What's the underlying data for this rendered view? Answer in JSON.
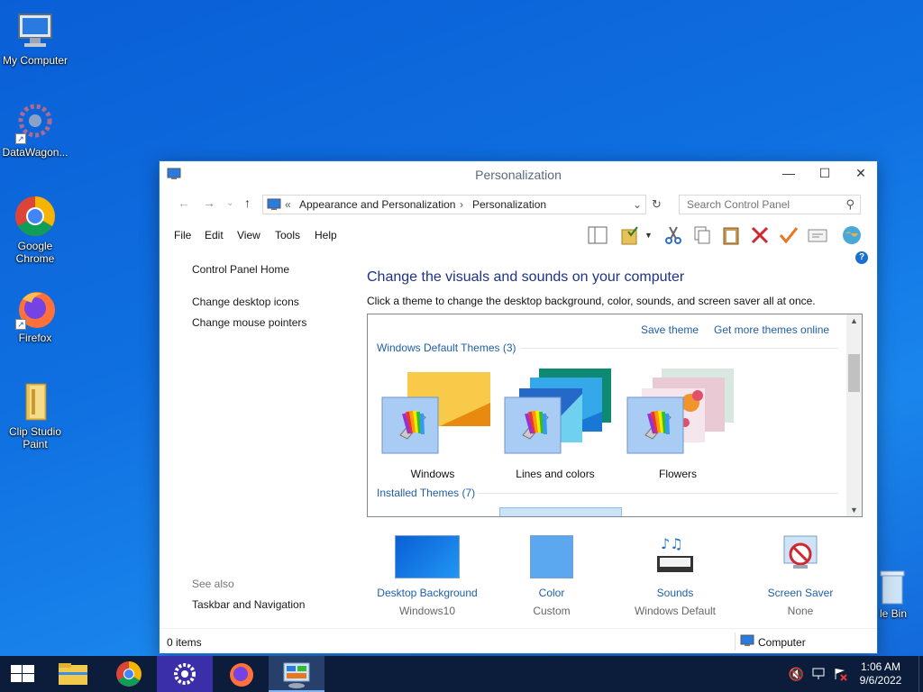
{
  "desktop": {
    "icons": [
      {
        "label": "My Computer"
      },
      {
        "label": "DataWagon..."
      },
      {
        "label": "Google Chrome"
      },
      {
        "label": "Firefox"
      },
      {
        "label": "Clip Studio Paint"
      },
      {
        "label": "le Bin"
      }
    ]
  },
  "window": {
    "title": "Personalization",
    "controls": {
      "minimize": "—",
      "maximize": "☐",
      "close": "✕"
    },
    "address": {
      "crumb_prefix": "«",
      "path": [
        "Appearance and Personalization",
        "Personalization"
      ]
    },
    "search": {
      "placeholder": "Search Control Panel"
    },
    "menu": [
      "File",
      "Edit",
      "View",
      "Tools",
      "Help"
    ],
    "left_pane": {
      "home": "Control Panel Home",
      "links": [
        "Change desktop icons",
        "Change mouse pointers"
      ],
      "see_also_title": "See also",
      "see_also": [
        "Taskbar and Navigation"
      ]
    },
    "heading": "Change the visuals and sounds on your computer",
    "subheading": "Click a theme to change the desktop background, color, sounds, and screen saver all at once.",
    "themes_panel": {
      "save_theme": "Save theme",
      "get_more": "Get more themes online",
      "default_group": "Windows Default Themes (3)",
      "installed_group": "Installed Themes (7)",
      "themes": [
        "Windows",
        "Lines and colors",
        "Flowers"
      ]
    },
    "bottom": [
      {
        "label": "Desktop Background",
        "value": "Windows10"
      },
      {
        "label": "Color",
        "value": "Custom"
      },
      {
        "label": "Sounds",
        "value": "Windows Default"
      },
      {
        "label": "Screen Saver",
        "value": "None"
      }
    ],
    "status": {
      "items": "0 items",
      "location": "Computer"
    }
  },
  "taskbar": {
    "time": "1:06 AM",
    "date": "9/6/2022"
  },
  "colors": {
    "accent": "#1a73d9",
    "link": "#1f5fa8",
    "heading": "#1e3287",
    "taskbar": "#0b1d3a"
  }
}
